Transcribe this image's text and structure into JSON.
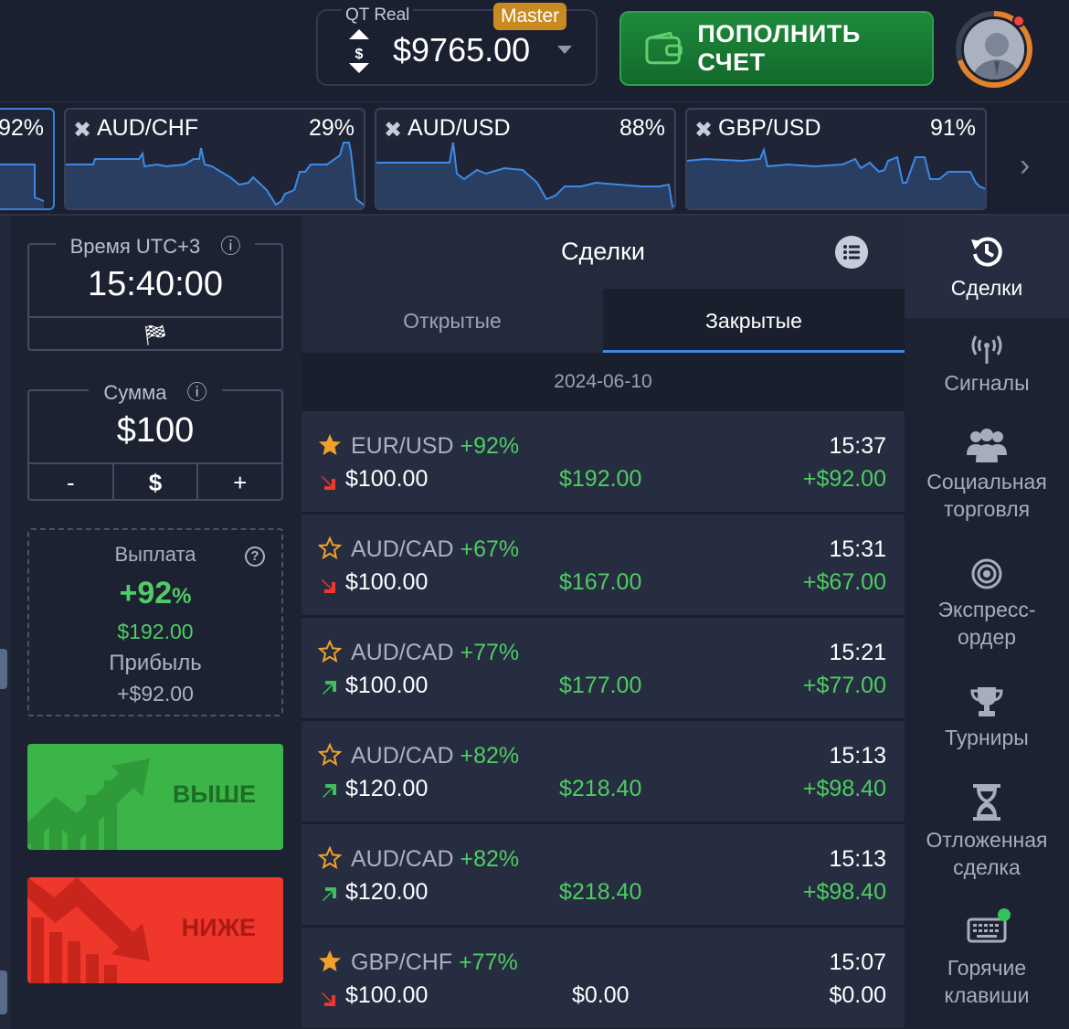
{
  "header": {
    "account_type": "QT Real",
    "account_badge": "Master",
    "balance": "$9765.00",
    "deposit_label": "ПОПОЛНИТЬ СЧЕТ"
  },
  "assets": [
    {
      "name": "",
      "percent": "92%"
    },
    {
      "name": "AUD/CHF",
      "percent": "29%"
    },
    {
      "name": "AUD/USD",
      "percent": "88%"
    },
    {
      "name": "GBP/USD",
      "percent": "91%"
    }
  ],
  "left_panel": {
    "time_label": "Время UTC+3",
    "time_value": "15:40:00",
    "amount_label": "Сумма",
    "amount_value": "$100",
    "minus": "-",
    "currency": "$",
    "plus": "+",
    "payout_label": "Выплата",
    "payout_percent": "+92",
    "payout_percent_sign": "%",
    "payout_amount": "$192.00",
    "profit_label": "Прибыль",
    "profit_amount": "+$92.00",
    "up_label": "ВЫШЕ",
    "down_label": "НИЖЕ"
  },
  "trades_panel": {
    "title": "Сделки",
    "tab_open": "Открытые",
    "tab_closed": "Закрытые",
    "date": "2024-06-10",
    "rows": [
      {
        "pair": "EUR/USD",
        "payout": "+92%",
        "time": "15:37",
        "amount": "$100.00",
        "return": "$192.00",
        "profit": "+$92.00",
        "direction": "down",
        "starred": true
      },
      {
        "pair": "AUD/CAD",
        "payout": "+67%",
        "time": "15:31",
        "amount": "$100.00",
        "return": "$167.00",
        "profit": "+$67.00",
        "direction": "down",
        "starred": false
      },
      {
        "pair": "AUD/CAD",
        "payout": "+77%",
        "time": "15:21",
        "amount": "$100.00",
        "return": "$177.00",
        "profit": "+$77.00",
        "direction": "up",
        "starred": false
      },
      {
        "pair": "AUD/CAD",
        "payout": "+82%",
        "time": "15:13",
        "amount": "$120.00",
        "return": "$218.40",
        "profit": "+$98.40",
        "direction": "up",
        "starred": false
      },
      {
        "pair": "AUD/CAD",
        "payout": "+82%",
        "time": "15:13",
        "amount": "$120.00",
        "return": "$218.40",
        "profit": "+$98.40",
        "direction": "up",
        "starred": false
      },
      {
        "pair": "GBP/CHF",
        "payout": "+77%",
        "time": "15:07",
        "amount": "$100.00",
        "return": "$0.00",
        "profit": "$0.00",
        "direction": "down",
        "starred": true
      }
    ]
  },
  "sidebar": {
    "trades": "Сделки",
    "signals": "Сигналы",
    "social_1": "Социальная",
    "social_2": "торговля",
    "express_1": "Экспресс-",
    "express_2": "ордер",
    "tournaments": "Турниры",
    "pending_1": "Отложенная",
    "pending_2": "сделка",
    "hotkeys_1": "Горячие",
    "hotkeys_2": "клавиши"
  },
  "colors": {
    "background": "#1d2233",
    "accent_blue": "#3f8ae0",
    "profit_green": "#4fcc63",
    "up_button": "#3cb548",
    "down_button": "#f0372b",
    "badge_orange": "#c98a22"
  }
}
